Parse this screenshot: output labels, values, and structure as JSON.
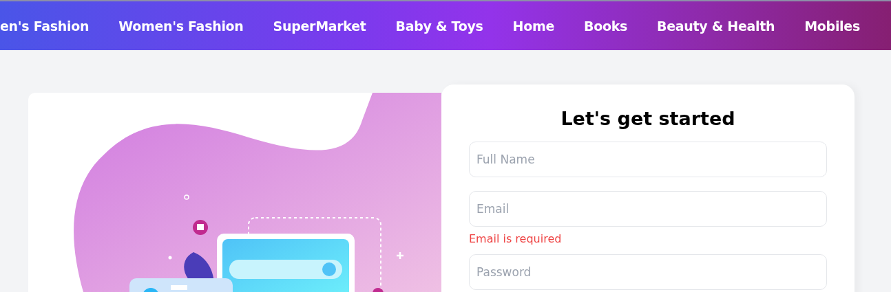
{
  "nav": {
    "items": [
      {
        "label": "en's Fashion"
      },
      {
        "label": "Women's Fashion"
      },
      {
        "label": "SuperMarket"
      },
      {
        "label": "Baby & Toys"
      },
      {
        "label": "Home"
      },
      {
        "label": "Books"
      },
      {
        "label": "Beauty & Health"
      },
      {
        "label": "Mobiles"
      }
    ]
  },
  "form": {
    "title": "Let's get started",
    "fields": [
      {
        "placeholder": "Full Name"
      },
      {
        "placeholder": "Email",
        "error": "Email is required"
      },
      {
        "placeholder": "Password"
      }
    ]
  }
}
